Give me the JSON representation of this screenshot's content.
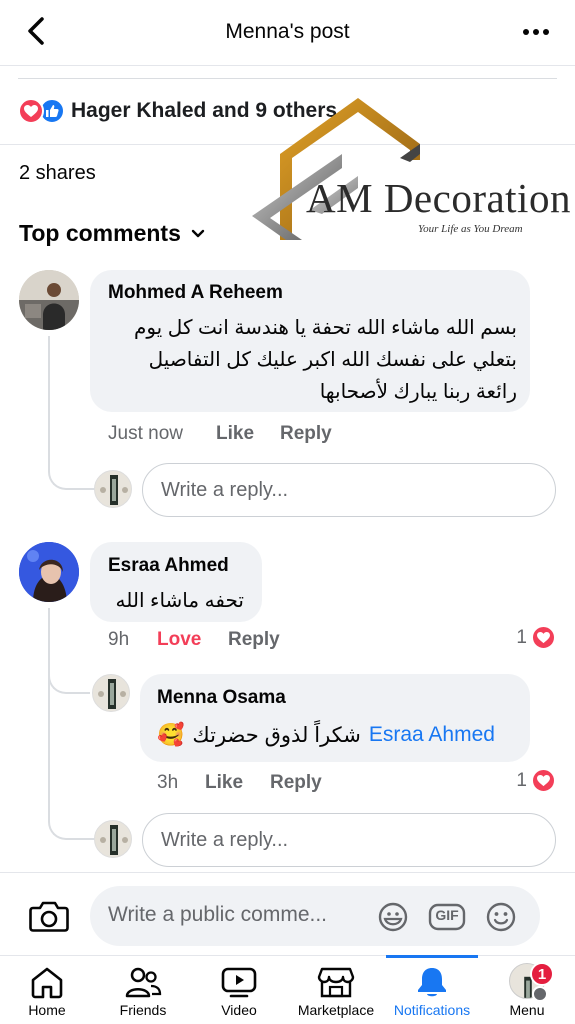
{
  "header": {
    "title": "Menna's post"
  },
  "post_stats": {
    "reactions_text": "Hager Khaled and 9 others",
    "shares": "2 shares"
  },
  "comments_section": {
    "sort_label": "Top comments"
  },
  "watermark": {
    "title": "AM Decoration",
    "tagline": "Your Life as You Dream"
  },
  "comments": [
    {
      "author": "Mohmed A Reheem",
      "lines": [
        "بسم الله ماشاء الله تحفة يا هندسة انت كل يوم",
        "بتعلي على نفسك الله اكبر عليك كل التفاصيل",
        "رائعة ربنا يبارك لأصحابها"
      ],
      "time": "Just now",
      "reaction_action": "Like",
      "reply_action": "Reply",
      "reply_placeholder": "Write a reply..."
    },
    {
      "author": "Esraa Ahmed",
      "text": "تحفه ماشاء الله",
      "time": "9h",
      "reaction_action": "Love",
      "reply_action": "Reply",
      "reaction_count": "1",
      "replies": [
        {
          "author": "Menna Osama",
          "mention": "Esraa Ahmed",
          "text": "شكراً لذوق حضرتك",
          "emoji": "🥰",
          "time": "3h",
          "reaction_action": "Like",
          "reply_action": "Reply",
          "reaction_count": "1"
        }
      ],
      "reply_placeholder": "Write a reply..."
    }
  ],
  "composer": {
    "placeholder": "Write a public comme...",
    "gif_label": "GIF"
  },
  "bottom_nav": {
    "items": [
      {
        "label": "Home",
        "icon": "home-icon"
      },
      {
        "label": "Friends",
        "icon": "friends-icon"
      },
      {
        "label": "Video",
        "icon": "video-icon"
      },
      {
        "label": "Marketplace",
        "icon": "marketplace-icon"
      },
      {
        "label": "Notifications",
        "icon": "bell-icon",
        "active": true
      },
      {
        "label": "Menu",
        "icon": "menu-avatar",
        "badge": "1"
      }
    ]
  },
  "colors": {
    "accent": "#1877f2",
    "love": "#f33e58",
    "bubble": "#f0f2f5",
    "secondary_text": "#65676b"
  }
}
